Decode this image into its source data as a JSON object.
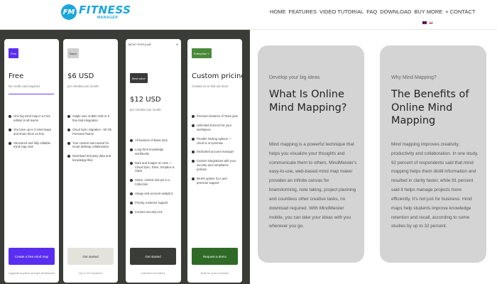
{
  "header": {
    "logo_badge": "FM",
    "logo_main": "FITNESS",
    "logo_sub": "MANAGER",
    "nav": [
      "HOME",
      "FEATURES",
      "VIDEO TUTORIAL",
      "FAQ",
      "DOWNLOAD",
      "BUY MORE",
      "+ CONTACT"
    ]
  },
  "pricing": {
    "cards": [
      {
        "badge": "Free",
        "name": "Free",
        "sub": "No credit card required",
        "features": [
          "One big mind map in a Free edition to all teams",
          "You have up to 3 mind maps and share them on free",
          "Structured and fully editable mind map view"
        ],
        "cta": "Create a free mind map",
        "note": "Upgrade anytime and get all features"
      },
      {
        "badge": "Basic",
        "name": "$6 USD",
        "sub": "per member per month",
        "features": [
          "Single user at $60 USD or 5 free trial integration",
          "Cloud Sync migration - 50 Gb Personal Teams",
          "Your content auto-saved for smart desktop collaboration",
          "Download 3rd-party data and knowledge files"
        ],
        "cta": "Get started",
        "note": "Up to 20 members"
      },
      {
        "popular_left": "MOST POPULAR",
        "popular_right": "✦",
        "badge": "Best value",
        "name": "$12 USD",
        "sub": "per member per month",
        "features": [
          "All features of Basic plus",
          "Long-form knowledge workbooks",
          "Dark and images on view — Cloud Sync, Drive, Dropbox & Slack",
          "Share, embed and pin to a Collection",
          "Usage and account analytics",
          "Priority customer support",
          "Content security lock"
        ],
        "cta": "Get started",
        "note": "Unlimited members"
      },
      {
        "badge": "Enterprise +",
        "name": "Custom pricing",
        "sub": "Contact us to find out more",
        "features": [
          "Premium features of Team plus",
          "Unlimited licences for your workspace",
          "Flexible hosting options — cloud or on-premise",
          "Dedicated account manager",
          "Custom integrations with your security and compliance policies",
          "99.9% uptime SLA and premium support"
        ],
        "cta": "Request a demo",
        "note": "Built for your business"
      }
    ]
  },
  "info": [
    {
      "kicker": "Develop your big ideas",
      "title": "What Is Online Mind Mapping?",
      "body": "Mind mapping is a powerful technique that helps you visualize your thoughts and communicate them to others. MindMeister's easy-to-use, web-based mind map maker provides an infinite canvas for brainstorming, note taking, project planning and countless other creative tasks, no download required. With MindMeister mobile, you can take your ideas with you wherever you go."
    },
    {
      "kicker": "Why Mind Mapping?",
      "title": "The Benefits of Online Mind Mapping",
      "body": "Mind mapping improves creativity, productivity and collaboration. In one study, 92 percent of respondents said that mind mapping helps them distill information and resulted in clarity faster, while 81 percent said it helps manage projects more efficiently. It's not just for business: mind maps help students improve knowledge retention and recall, according to some studies by up to 32 percent."
    }
  ]
}
